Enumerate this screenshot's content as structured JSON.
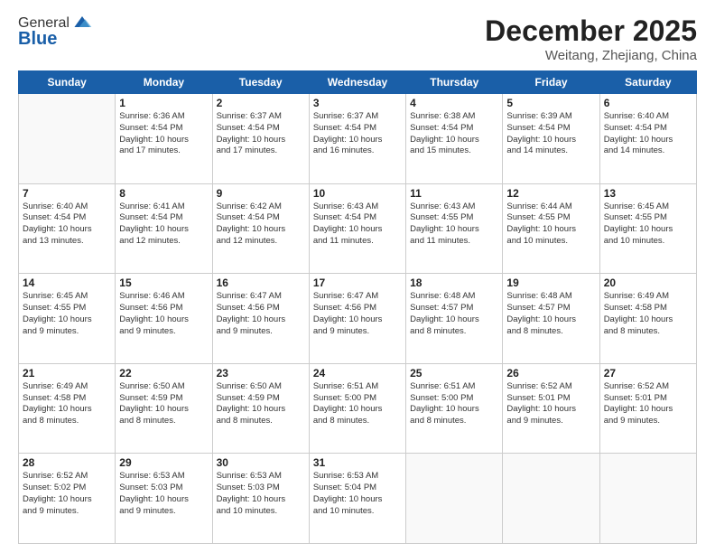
{
  "logo": {
    "general": "General",
    "blue": "Blue"
  },
  "header": {
    "month": "December 2025",
    "location": "Weitang, Zhejiang, China"
  },
  "days_of_week": [
    "Sunday",
    "Monday",
    "Tuesday",
    "Wednesday",
    "Thursday",
    "Friday",
    "Saturday"
  ],
  "weeks": [
    [
      {
        "day": "",
        "info": ""
      },
      {
        "day": "1",
        "info": "Sunrise: 6:36 AM\nSunset: 4:54 PM\nDaylight: 10 hours\nand 17 minutes."
      },
      {
        "day": "2",
        "info": "Sunrise: 6:37 AM\nSunset: 4:54 PM\nDaylight: 10 hours\nand 17 minutes."
      },
      {
        "day": "3",
        "info": "Sunrise: 6:37 AM\nSunset: 4:54 PM\nDaylight: 10 hours\nand 16 minutes."
      },
      {
        "day": "4",
        "info": "Sunrise: 6:38 AM\nSunset: 4:54 PM\nDaylight: 10 hours\nand 15 minutes."
      },
      {
        "day": "5",
        "info": "Sunrise: 6:39 AM\nSunset: 4:54 PM\nDaylight: 10 hours\nand 14 minutes."
      },
      {
        "day": "6",
        "info": "Sunrise: 6:40 AM\nSunset: 4:54 PM\nDaylight: 10 hours\nand 14 minutes."
      }
    ],
    [
      {
        "day": "7",
        "info": "Sunrise: 6:40 AM\nSunset: 4:54 PM\nDaylight: 10 hours\nand 13 minutes."
      },
      {
        "day": "8",
        "info": "Sunrise: 6:41 AM\nSunset: 4:54 PM\nDaylight: 10 hours\nand 12 minutes."
      },
      {
        "day": "9",
        "info": "Sunrise: 6:42 AM\nSunset: 4:54 PM\nDaylight: 10 hours\nand 12 minutes."
      },
      {
        "day": "10",
        "info": "Sunrise: 6:43 AM\nSunset: 4:54 PM\nDaylight: 10 hours\nand 11 minutes."
      },
      {
        "day": "11",
        "info": "Sunrise: 6:43 AM\nSunset: 4:55 PM\nDaylight: 10 hours\nand 11 minutes."
      },
      {
        "day": "12",
        "info": "Sunrise: 6:44 AM\nSunset: 4:55 PM\nDaylight: 10 hours\nand 10 minutes."
      },
      {
        "day": "13",
        "info": "Sunrise: 6:45 AM\nSunset: 4:55 PM\nDaylight: 10 hours\nand 10 minutes."
      }
    ],
    [
      {
        "day": "14",
        "info": "Sunrise: 6:45 AM\nSunset: 4:55 PM\nDaylight: 10 hours\nand 9 minutes."
      },
      {
        "day": "15",
        "info": "Sunrise: 6:46 AM\nSunset: 4:56 PM\nDaylight: 10 hours\nand 9 minutes."
      },
      {
        "day": "16",
        "info": "Sunrise: 6:47 AM\nSunset: 4:56 PM\nDaylight: 10 hours\nand 9 minutes."
      },
      {
        "day": "17",
        "info": "Sunrise: 6:47 AM\nSunset: 4:56 PM\nDaylight: 10 hours\nand 9 minutes."
      },
      {
        "day": "18",
        "info": "Sunrise: 6:48 AM\nSunset: 4:57 PM\nDaylight: 10 hours\nand 8 minutes."
      },
      {
        "day": "19",
        "info": "Sunrise: 6:48 AM\nSunset: 4:57 PM\nDaylight: 10 hours\nand 8 minutes."
      },
      {
        "day": "20",
        "info": "Sunrise: 6:49 AM\nSunset: 4:58 PM\nDaylight: 10 hours\nand 8 minutes."
      }
    ],
    [
      {
        "day": "21",
        "info": "Sunrise: 6:49 AM\nSunset: 4:58 PM\nDaylight: 10 hours\nand 8 minutes."
      },
      {
        "day": "22",
        "info": "Sunrise: 6:50 AM\nSunset: 4:59 PM\nDaylight: 10 hours\nand 8 minutes."
      },
      {
        "day": "23",
        "info": "Sunrise: 6:50 AM\nSunset: 4:59 PM\nDaylight: 10 hours\nand 8 minutes."
      },
      {
        "day": "24",
        "info": "Sunrise: 6:51 AM\nSunset: 5:00 PM\nDaylight: 10 hours\nand 8 minutes."
      },
      {
        "day": "25",
        "info": "Sunrise: 6:51 AM\nSunset: 5:00 PM\nDaylight: 10 hours\nand 8 minutes."
      },
      {
        "day": "26",
        "info": "Sunrise: 6:52 AM\nSunset: 5:01 PM\nDaylight: 10 hours\nand 9 minutes."
      },
      {
        "day": "27",
        "info": "Sunrise: 6:52 AM\nSunset: 5:01 PM\nDaylight: 10 hours\nand 9 minutes."
      }
    ],
    [
      {
        "day": "28",
        "info": "Sunrise: 6:52 AM\nSunset: 5:02 PM\nDaylight: 10 hours\nand 9 minutes."
      },
      {
        "day": "29",
        "info": "Sunrise: 6:53 AM\nSunset: 5:03 PM\nDaylight: 10 hours\nand 9 minutes."
      },
      {
        "day": "30",
        "info": "Sunrise: 6:53 AM\nSunset: 5:03 PM\nDaylight: 10 hours\nand 10 minutes."
      },
      {
        "day": "31",
        "info": "Sunrise: 6:53 AM\nSunset: 5:04 PM\nDaylight: 10 hours\nand 10 minutes."
      },
      {
        "day": "",
        "info": ""
      },
      {
        "day": "",
        "info": ""
      },
      {
        "day": "",
        "info": ""
      }
    ]
  ]
}
